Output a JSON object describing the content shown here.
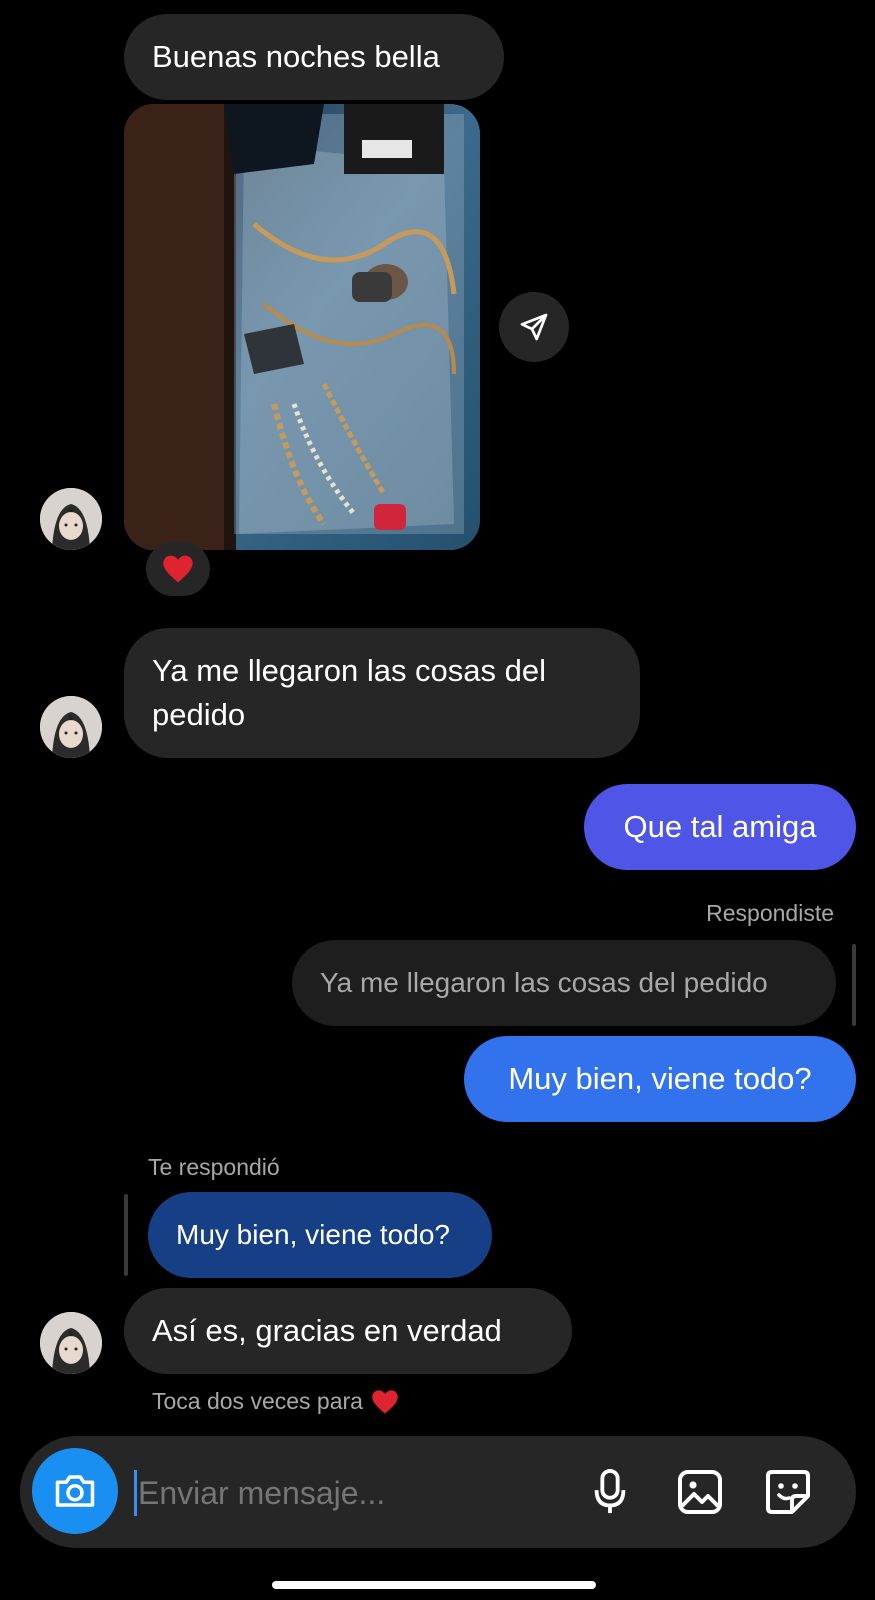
{
  "messages": {
    "greeting": "Buenas noches bella",
    "arrived": "Ya me llegaron las cosas del pedido",
    "que_tal": "Que tal amiga",
    "replied_label": "Respondiste",
    "replied_quote": "Ya me llegaron las cosas del pedido",
    "muy_bien": "Muy bien, viene todo?",
    "they_replied_label": "Te respondió",
    "they_replied_quote": "Muy bien, viene todo?",
    "asi_es": "Así es, gracias en verdad",
    "double_tap_hint": "Toca dos veces para"
  },
  "reaction": "heart",
  "composer": {
    "placeholder": "Enviar mensaje..."
  },
  "colors": {
    "incoming_bubble": "#262626",
    "outgoing_purple": "#4f55e6",
    "outgoing_blue": "#3272ec",
    "quote_bubble_blue": "#173f86",
    "camera_button": "#1a8ff2",
    "heart": "#e0242f"
  },
  "icons": {
    "share": "send-icon",
    "camera": "camera-icon",
    "mic": "microphone-icon",
    "gallery": "image-icon",
    "sticker": "sticker-icon"
  }
}
